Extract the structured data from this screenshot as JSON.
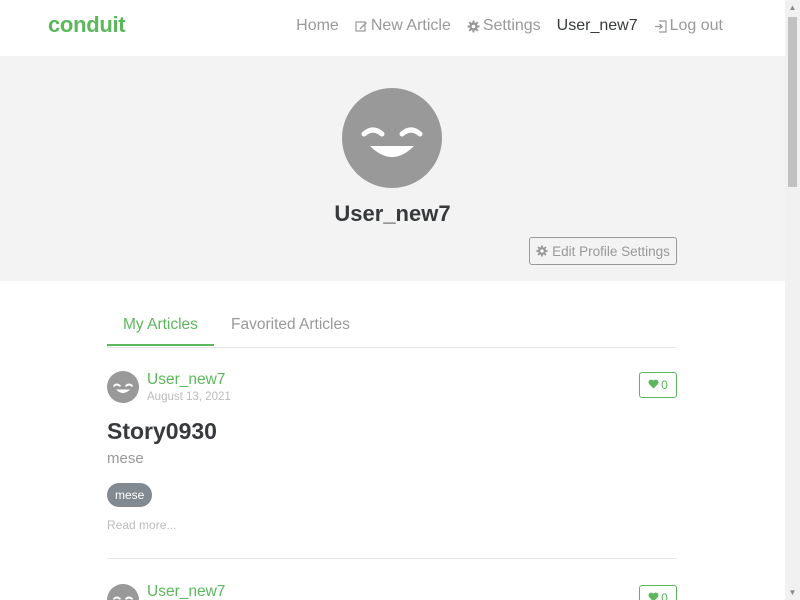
{
  "navbar": {
    "brand": "conduit",
    "items": [
      {
        "label": "Home",
        "icon": "",
        "active": false
      },
      {
        "label": "New Article",
        "icon": "edit-icon",
        "active": false
      },
      {
        "label": "Settings",
        "icon": "gear-icon",
        "active": false
      },
      {
        "label": "User_new7",
        "icon": "",
        "active": true
      },
      {
        "label": "Log out",
        "icon": "logout-icon",
        "active": false
      }
    ]
  },
  "profile": {
    "username": "User_new7",
    "edit_button_label": "Edit Profile Settings"
  },
  "tabs": [
    {
      "label": "My Articles",
      "active": true
    },
    {
      "label": "Favorited Articles",
      "active": false
    }
  ],
  "articles": [
    {
      "author": "User_new7",
      "date": "August 13, 2021",
      "likes": "0",
      "title": "Story0930",
      "description": "mese",
      "tags": [
        "mese"
      ],
      "read_more": "Read more..."
    },
    {
      "author": "User_new7",
      "likes": "0"
    }
  ],
  "colors": {
    "brand": "#5cb85c",
    "muted": "#999999",
    "banner": "#f3f3f3",
    "tag": "#818a91"
  }
}
